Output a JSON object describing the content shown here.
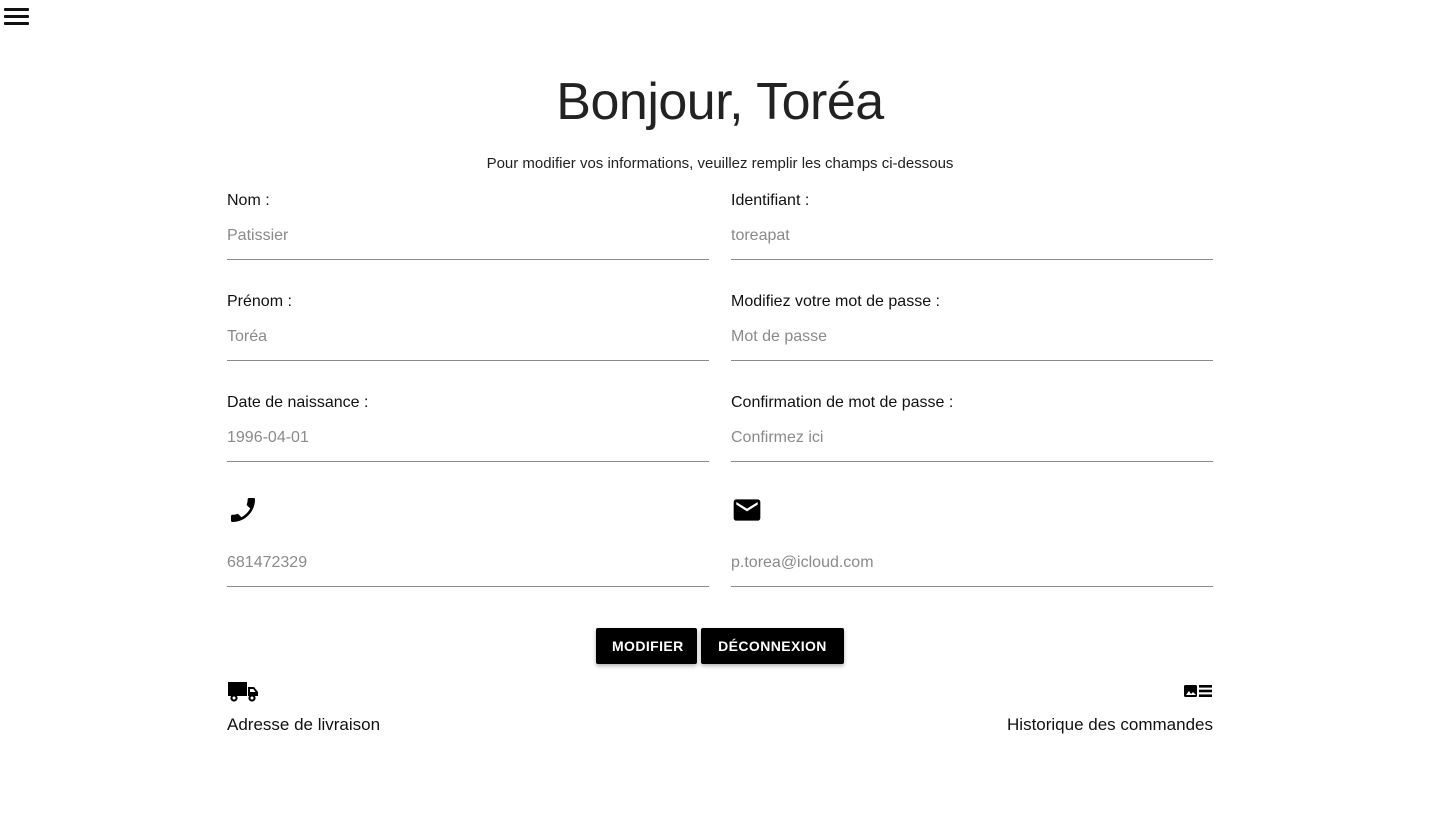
{
  "header": {
    "menu_icon": "hamburger-menu-icon"
  },
  "title": "Bonjour, Toréa",
  "subtitle": "Pour modifier vos informations, veuillez remplir les champs ci-dessous",
  "form": {
    "nom": {
      "label": "Nom :",
      "placeholder": "Patissier"
    },
    "identifiant": {
      "label": "Identifiant :",
      "placeholder": "toreapat"
    },
    "prenom": {
      "label": "Prénom :",
      "placeholder": "Toréa"
    },
    "password": {
      "label": "Modifiez votre mot de passe :",
      "placeholder": "Mot de passe"
    },
    "birthdate": {
      "label": "Date de naissance :",
      "placeholder": "1996-04-01"
    },
    "confirm": {
      "label": "Confirmation de mot de passe :",
      "placeholder": "Confirmez ici"
    },
    "phone": {
      "icon": "phone-icon",
      "placeholder": "681472329"
    },
    "email": {
      "icon": "email-icon",
      "placeholder": "p.torea@icloud.com"
    }
  },
  "buttons": {
    "modifier": "MODIFIER",
    "logout": "DÉCONNEXION"
  },
  "links": {
    "delivery": {
      "icon": "truck-icon",
      "label": "Adresse de livraison"
    },
    "orders": {
      "icon": "order-history-icon",
      "label": "Historique des commandes"
    }
  }
}
